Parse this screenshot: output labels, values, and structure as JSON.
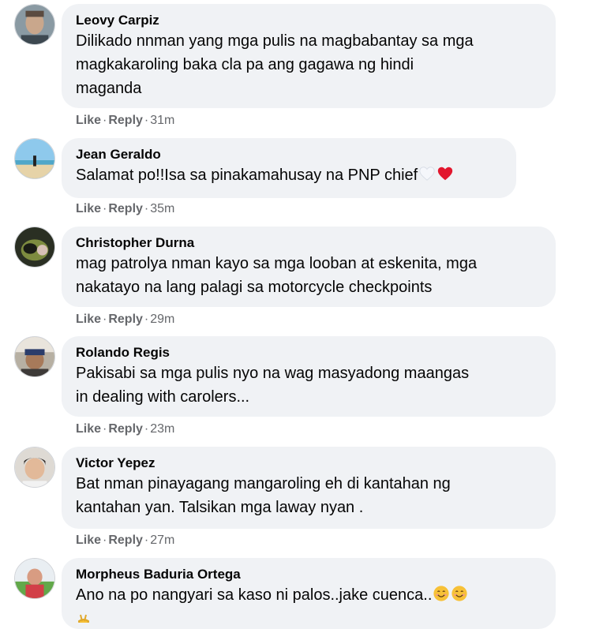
{
  "comments": [
    {
      "author": "Leovy Carpiz",
      "lines": [
        "Dilikado nnman yang mga pulis na magbabantay sa mga",
        "magkakaroling baka cla pa ang gagawa ng hindi",
        "maganda"
      ],
      "like": "Like",
      "reply": "Reply",
      "time": "31m"
    },
    {
      "author": "Jean Geraldo",
      "text": "Salamat po!!Isa sa pinakamahusay na PNP chief",
      "emoji": [
        "white-heart",
        "red-heart"
      ],
      "like": "Like",
      "reply": "Reply",
      "time": "35m"
    },
    {
      "author": "Christopher Durna",
      "lines": [
        "mag patrolya nman kayo sa mga looban at eskenita, mga",
        "nakatayo na lang palagi sa motorcycle checkpoints"
      ],
      "like": "Like",
      "reply": "Reply",
      "time": "29m"
    },
    {
      "author": "Rolando Regis",
      "lines": [
        "Pakisabi sa mga pulis nyo na wag masyadong maangas",
        "in dealing with carolers..."
      ],
      "like": "Like",
      "reply": "Reply",
      "time": "23m"
    },
    {
      "author": "Victor Yepez",
      "lines": [
        "Bat nman pinayagang mangaroling eh di kantahan ng",
        "kantahan yan. Talsikan mga laway nyan ."
      ],
      "like": "Like",
      "reply": "Reply",
      "time": "27m"
    },
    {
      "author": "Morpheus Baduria Ortega",
      "text": "Ano na po nangyari sa kaso ni palos..jake cuenca..",
      "emoji": [
        "smiling-face",
        "smiling-face"
      ]
    }
  ],
  "separator": "·"
}
